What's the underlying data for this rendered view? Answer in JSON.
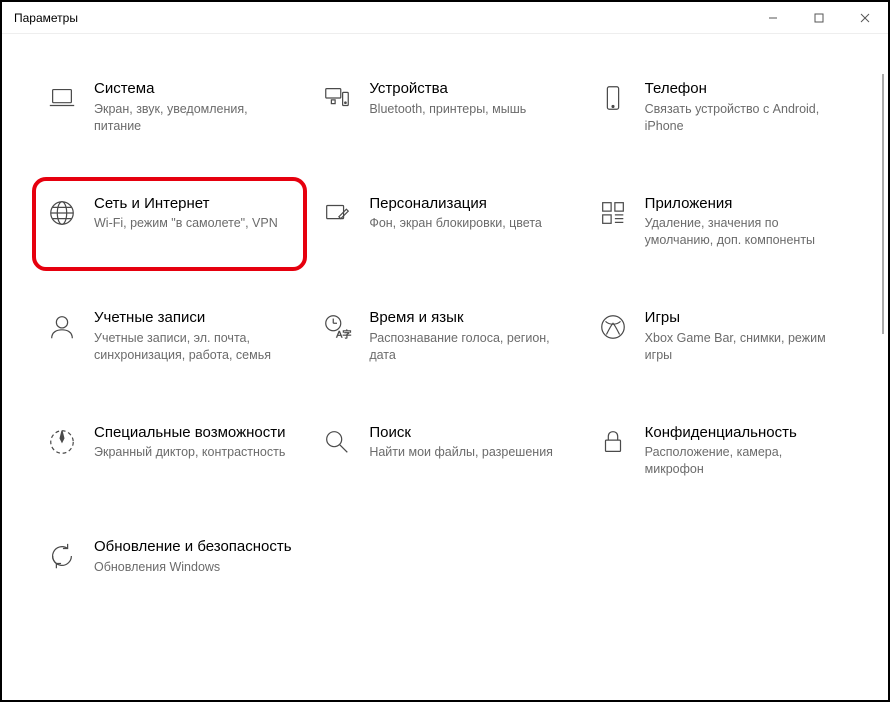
{
  "window": {
    "title": "Параметры"
  },
  "tiles": [
    {
      "id": "system",
      "label": "Система",
      "desc": "Экран, звук, уведомления, питание"
    },
    {
      "id": "devices",
      "label": "Устройства",
      "desc": "Bluetooth, принтеры, мышь"
    },
    {
      "id": "phone",
      "label": "Телефон",
      "desc": "Связать устройство с Android, iPhone"
    },
    {
      "id": "network",
      "label": "Сеть и Интернет",
      "desc": "Wi-Fi, режим \"в самолете\", VPN"
    },
    {
      "id": "personalize",
      "label": "Персонализация",
      "desc": "Фон, экран блокировки, цвета"
    },
    {
      "id": "apps",
      "label": "Приложения",
      "desc": "Удаление, значения по умолчанию, доп. компоненты"
    },
    {
      "id": "accounts",
      "label": "Учетные записи",
      "desc": "Учетные записи, эл. почта, синхронизация, работа, семья"
    },
    {
      "id": "time",
      "label": "Время и язык",
      "desc": "Распознавание голоса, регион, дата"
    },
    {
      "id": "gaming",
      "label": "Игры",
      "desc": "Xbox Game Bar, снимки, режим игры"
    },
    {
      "id": "ease",
      "label": "Специальные возможности",
      "desc": "Экранный диктор, контрастность"
    },
    {
      "id": "search",
      "label": "Поиск",
      "desc": "Найти мои файлы, разрешения"
    },
    {
      "id": "privacy",
      "label": "Конфиденциальность",
      "desc": "Расположение, камера, микрофон"
    },
    {
      "id": "update",
      "label": "Обновление и безопасность",
      "desc": "Обновления Windows"
    }
  ]
}
